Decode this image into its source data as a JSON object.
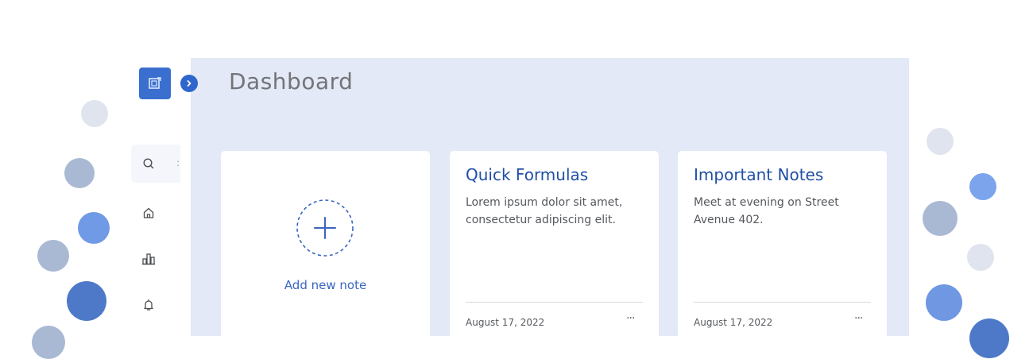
{
  "page": {
    "title": "Dashboard"
  },
  "sidebar": {
    "items": [
      {
        "icon": "search-icon"
      },
      {
        "icon": "home-icon"
      },
      {
        "icon": "bar-chart-icon"
      },
      {
        "icon": "bell-icon"
      }
    ],
    "truncated_mark": ":"
  },
  "notes": {
    "add_new_label": "Add new note",
    "cards": [
      {
        "title": "Quick Formulas",
        "body": "Lorem ipsum dolor sit amet, consectetur adipiscing elit.",
        "date": "August 17, 2022",
        "more": "···"
      },
      {
        "title": "Important Notes",
        "body": "Meet at evening on Street Avenue 402.",
        "date": "August 17, 2022",
        "more": "···"
      }
    ]
  },
  "colors": {
    "accent": "#2f66cc",
    "panel_bg": "#e3e9f6",
    "card_title": "#1f4fa5"
  }
}
